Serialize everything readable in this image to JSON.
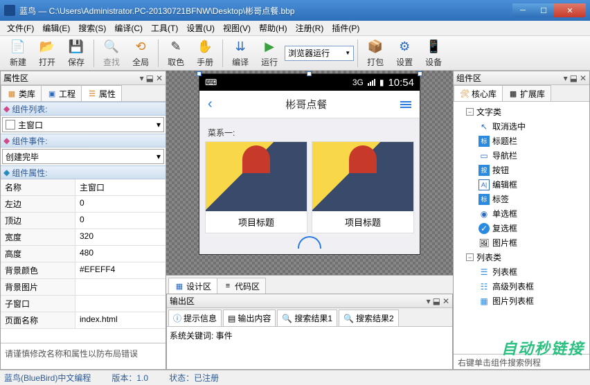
{
  "window": {
    "title": "蓝鸟 — C:\\Users\\Administrator.PC-20130721BFNW\\Desktop\\彬哥点餐.bbp"
  },
  "menubar": [
    "文件(F)",
    "编辑(E)",
    "搜索(S)",
    "编译(C)",
    "工具(T)",
    "设置(U)",
    "视图(V)",
    "帮助(H)",
    "注册(R)",
    "插件(P)"
  ],
  "toolbar": {
    "new": "新建",
    "open": "打开",
    "save": "保存",
    "find": "查找",
    "global": "全局",
    "pick": "取色",
    "manual": "手册",
    "compile": "编译",
    "run": "运行",
    "runmode": "浏览器运行",
    "pack": "打包",
    "settings": "设置",
    "device": "设备"
  },
  "left": {
    "panel_title": "属性区",
    "tabs": {
      "lib": "类库",
      "project": "工程",
      "props": "属性"
    },
    "sec_list": "组件列表:",
    "dd_main": "主窗口",
    "sec_events": "组件事件:",
    "dd_event": "创建完毕",
    "sec_props": "组件属性:",
    "props": [
      {
        "k": "名称",
        "v": "主窗口"
      },
      {
        "k": "左边",
        "v": "0"
      },
      {
        "k": "顶边",
        "v": "0"
      },
      {
        "k": "宽度",
        "v": "320"
      },
      {
        "k": "高度",
        "v": "480"
      },
      {
        "k": "背景颜色",
        "v": "#EFEFF4"
      },
      {
        "k": "背景图片",
        "v": ""
      },
      {
        "k": "子窗口",
        "v": ""
      },
      {
        "k": "页面名称",
        "v": "index.html"
      }
    ],
    "hint": "请谨慎修改名称和属性以防布局错误"
  },
  "center": {
    "phone": {
      "time": "10:54",
      "sig": "3G",
      "title": "彬哥点餐",
      "section": "菜系一:",
      "card": "项目标题"
    },
    "tabs": {
      "design": "设计区",
      "code": "代码区"
    },
    "out": {
      "title": "输出区",
      "tabs": {
        "tips": "提示信息",
        "content": "输出内容",
        "res1": "搜索结果1",
        "res2": "搜索结果2"
      },
      "body": "系统关键词: 事件"
    }
  },
  "right": {
    "title": "组件区",
    "tabs": {
      "core": "核心库",
      "ext": "扩展库"
    },
    "tree": {
      "textcat": "文字类",
      "items1": [
        "取消选中",
        "标题栏",
        "导航栏",
        "按钮",
        "编辑框",
        "标签",
        "单选框",
        "复选框",
        "图片框"
      ],
      "listcat": "列表类",
      "items2": [
        "列表框",
        "高级列表框",
        "图片列表框"
      ]
    },
    "hint": "右键单击组件搜索例程"
  },
  "status": {
    "app": "蓝鸟(BlueBird)中文编程",
    "ver_label": "版本：",
    "ver": "1.0",
    "state_label": "状态：",
    "state": "已注册"
  },
  "watermark": "自动秒链接"
}
